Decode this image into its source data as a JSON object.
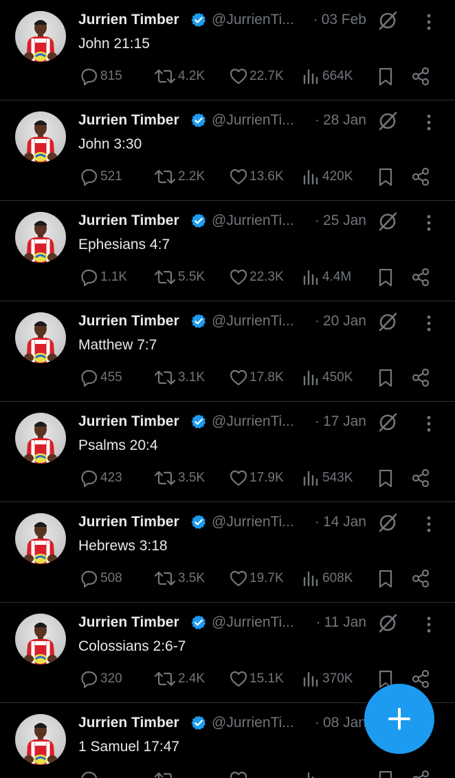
{
  "author": {
    "name": "Jurrien Timber",
    "handle": "@JurrienTi...",
    "separator": "·"
  },
  "colors": {
    "background": "#000000",
    "text_primary": "#e7e9ea",
    "text_secondary": "#71767b",
    "verified_badge": "#1d9bf0",
    "compose_button": "#1d9bf0",
    "divider": "#2f3336"
  },
  "icons": {
    "verified": "verified-badge-icon",
    "grok": "grok-icon",
    "more": "more-vertical-icon",
    "reply": "reply-icon",
    "retweet": "retweet-icon",
    "like": "heart-icon",
    "views": "views-icon",
    "bookmark": "bookmark-icon",
    "share": "share-icon",
    "compose": "plus-icon"
  },
  "tweets": [
    {
      "date": "03 Feb",
      "text": "John 21:15",
      "replies": "815",
      "retweets": "4.2K",
      "likes": "22.7K",
      "views": "664K"
    },
    {
      "date": "28 Jan",
      "text": "John 3:30",
      "replies": "521",
      "retweets": "2.2K",
      "likes": "13.6K",
      "views": "420K"
    },
    {
      "date": "25 Jan",
      "text": "Ephesians 4:7",
      "replies": "1.1K",
      "retweets": "5.5K",
      "likes": "22.3K",
      "views": "4.4M"
    },
    {
      "date": "20 Jan",
      "text": "Matthew 7:7",
      "replies": "455",
      "retweets": "3.1K",
      "likes": "17.8K",
      "views": "450K"
    },
    {
      "date": "17 Jan",
      "text": "Psalms 20:4",
      "replies": "423",
      "retweets": "3.5K",
      "likes": "17.9K",
      "views": "543K"
    },
    {
      "date": "14 Jan",
      "text": "Hebrews 3:18",
      "replies": "508",
      "retweets": "3.5K",
      "likes": "19.7K",
      "views": "608K"
    },
    {
      "date": "11 Jan",
      "text": "Colossians 2:6-7",
      "replies": "320",
      "retweets": "2.4K",
      "likes": "15.1K",
      "views": "370K"
    },
    {
      "date": "08 Jan",
      "text": "1 Samuel 17:47",
      "replies": "",
      "retweets": "",
      "likes": "",
      "views": ""
    }
  ]
}
